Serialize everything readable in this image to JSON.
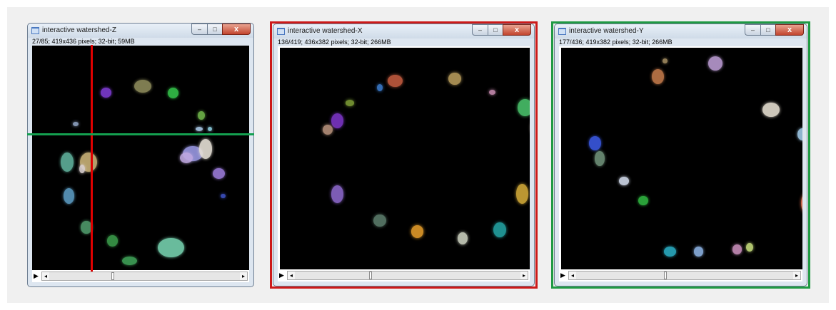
{
  "windows": [
    {
      "id": "z",
      "title": "interactive watershed-Z",
      "info": "27/85; 419x436 pixels; 32-bit; 59MB",
      "outline_color": "",
      "blobs": [
        [
          "#7d3bd1",
          0.34,
          0.21,
          0.05,
          0.045
        ],
        [
          "#8c8a5a",
          0.51,
          0.18,
          0.08,
          0.06
        ],
        [
          "#34c04a",
          0.65,
          0.21,
          0.05,
          0.05
        ],
        [
          "#6fb44a",
          0.78,
          0.31,
          0.035,
          0.04
        ],
        [
          "#8ea2c2",
          0.2,
          0.35,
          0.025,
          0.02
        ],
        [
          "#a9c8e6",
          0.77,
          0.37,
          0.035,
          0.02
        ],
        [
          "#8dcfe0",
          0.82,
          0.37,
          0.02,
          0.02
        ],
        [
          "#9a98e3",
          0.74,
          0.48,
          0.09,
          0.07
        ],
        [
          "#e6e0d6",
          0.8,
          0.46,
          0.06,
          0.09
        ],
        [
          "#bfa8e0",
          0.71,
          0.5,
          0.06,
          0.05
        ],
        [
          "#5fb09b",
          0.16,
          0.52,
          0.06,
          0.09
        ],
        [
          "#c9b277",
          0.26,
          0.52,
          0.08,
          0.09
        ],
        [
          "#dad0d0",
          0.23,
          0.55,
          0.025,
          0.04
        ],
        [
          "#9a7ad8",
          0.86,
          0.57,
          0.055,
          0.05
        ],
        [
          "#5a9ac0",
          0.17,
          0.67,
          0.05,
          0.07
        ],
        [
          "#3c50c0",
          0.88,
          0.67,
          0.02,
          0.02
        ],
        [
          "#4f9a6b",
          0.25,
          0.81,
          0.05,
          0.06
        ],
        [
          "#3a9a4a",
          0.37,
          0.87,
          0.05,
          0.05
        ],
        [
          "#75d0ad",
          0.64,
          0.9,
          0.12,
          0.09
        ],
        [
          "#3fa057",
          0.45,
          0.96,
          0.07,
          0.04
        ]
      ],
      "cursor_color_v": "#e00000",
      "cursor_color_h": "#14a050"
    },
    {
      "id": "x",
      "title": "interactive watershed-X",
      "info": "136/419; 436x382 pixels; 32-bit; 266MB",
      "outline_color": "#cc1a1a",
      "blobs": [
        [
          "#c05a3f",
          0.46,
          0.15,
          0.06,
          0.05
        ],
        [
          "#b59a5a",
          0.7,
          0.14,
          0.05,
          0.05
        ],
        [
          "#3a79c8",
          0.4,
          0.18,
          0.025,
          0.03
        ],
        [
          "#c58aae",
          0.85,
          0.2,
          0.025,
          0.02
        ],
        [
          "#49c06a",
          0.98,
          0.27,
          0.06,
          0.07
        ],
        [
          "#7a9a35",
          0.28,
          0.25,
          0.035,
          0.025
        ],
        [
          "#7b35c5",
          0.23,
          0.33,
          0.05,
          0.06
        ],
        [
          "#e8c8b8",
          1.04,
          0.36,
          0.07,
          0.08
        ],
        [
          "#b5907a",
          0.19,
          0.37,
          0.04,
          0.04
        ],
        [
          "#2b9ab0",
          1.1,
          0.56,
          0.07,
          0.06
        ],
        [
          "#d0a838",
          0.97,
          0.66,
          0.05,
          0.08
        ],
        [
          "#8a66c8",
          0.23,
          0.66,
          0.05,
          0.07
        ],
        [
          "#5a7a6a",
          0.4,
          0.78,
          0.05,
          0.05
        ],
        [
          "#e09a2a",
          0.55,
          0.83,
          0.05,
          0.05
        ],
        [
          "#c8cebc",
          0.73,
          0.86,
          0.04,
          0.05
        ],
        [
          "#23a0a0",
          0.88,
          0.82,
          0.05,
          0.06
        ]
      ]
    },
    {
      "id": "y",
      "title": "interactive watershed-Y",
      "info": "177/436; 419x382 pixels; 32-bit; 266MB",
      "outline_color": "#1f9a44",
      "blobs": [
        [
          "#c0784a",
          0.4,
          0.13,
          0.05,
          0.06
        ],
        [
          "#a08a60",
          0.43,
          0.06,
          0.02,
          0.02
        ],
        [
          "#b89ad0",
          0.64,
          0.07,
          0.06,
          0.06
        ],
        [
          "#e4ddcf",
          0.87,
          0.28,
          0.07,
          0.06
        ],
        [
          "#3a58e0",
          0.14,
          0.43,
          0.05,
          0.06
        ],
        [
          "#9ec8e6",
          1.0,
          0.39,
          0.04,
          0.05
        ],
        [
          "#8a78d8",
          1.05,
          0.45,
          0.04,
          0.04
        ],
        [
          "#7cc78a",
          1.07,
          0.52,
          0.07,
          0.1
        ],
        [
          "#6e8f78",
          0.16,
          0.5,
          0.04,
          0.06
        ],
        [
          "#cfd7e8",
          0.26,
          0.6,
          0.04,
          0.035
        ],
        [
          "#e07050",
          1.03,
          0.7,
          0.07,
          0.1
        ],
        [
          "#2fb340",
          0.34,
          0.69,
          0.04,
          0.04
        ],
        [
          "#4c7a86",
          1.03,
          0.82,
          0.04,
          0.05
        ],
        [
          "#2aaac0",
          0.45,
          0.92,
          0.05,
          0.04
        ],
        [
          "#8ab0e0",
          0.57,
          0.92,
          0.04,
          0.04
        ],
        [
          "#c78db8",
          0.73,
          0.91,
          0.04,
          0.04
        ],
        [
          "#c4da7a",
          0.78,
          0.9,
          0.03,
          0.035
        ]
      ]
    }
  ],
  "controls": {
    "play_icon": "play-icon",
    "scroll_left": "◂",
    "scroll_right": "▸",
    "btn_close": "x"
  }
}
